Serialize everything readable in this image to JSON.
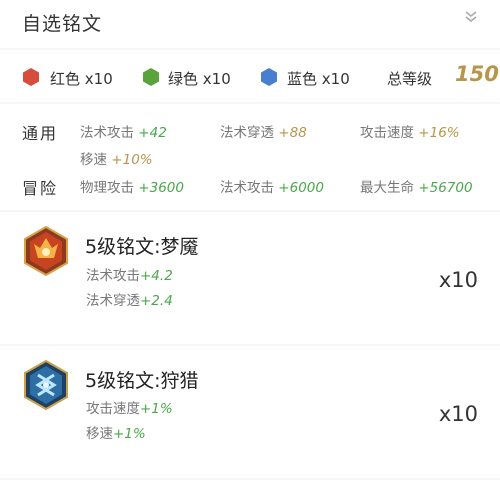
{
  "header": {
    "title": "自选铭文",
    "chevron_icon": "double-chevron-down-icon"
  },
  "summary": {
    "gems": [
      {
        "icon": "red-hexagon-icon",
        "color": "#d84c3e",
        "label": "红色 x10"
      },
      {
        "icon": "green-hexagon-icon",
        "color": "#5aa33a",
        "label": "绿色 x10"
      },
      {
        "icon": "blue-hexagon-icon",
        "color": "#4a7fcf",
        "label": "蓝色 x10"
      }
    ],
    "level_label": "总等级",
    "level_value": "150"
  },
  "stats": {
    "general_label": "通用",
    "adventure_label": "冒险",
    "general": [
      {
        "name": "法术攻击 ",
        "value": "+42"
      },
      {
        "name": "法术穿透 ",
        "value": "+88"
      },
      {
        "name": "攻击速度 ",
        "value": "+16%"
      },
      {
        "name": "移速 ",
        "value": "+10%"
      }
    ],
    "adventure": [
      {
        "name": "物理攻击 ",
        "value": "+3600"
      },
      {
        "name": "法术攻击 ",
        "value": "+6000"
      },
      {
        "name": "最大生命 ",
        "value": "+56700"
      }
    ]
  },
  "runes": [
    {
      "icon": "red-rune-icon",
      "name": "5级铭文:梦魇",
      "effects": [
        {
          "name": "法术攻击",
          "value": "+4.2"
        },
        {
          "name": "法术穿透",
          "value": "+2.4"
        }
      ],
      "count": "x10"
    },
    {
      "icon": "blue-rune-icon",
      "name": "5级铭文:狩猎",
      "effects": [
        {
          "name": "攻击速度",
          "value": "+1%"
        },
        {
          "name": "移速",
          "value": "+1%"
        }
      ],
      "count": "x10"
    }
  ]
}
